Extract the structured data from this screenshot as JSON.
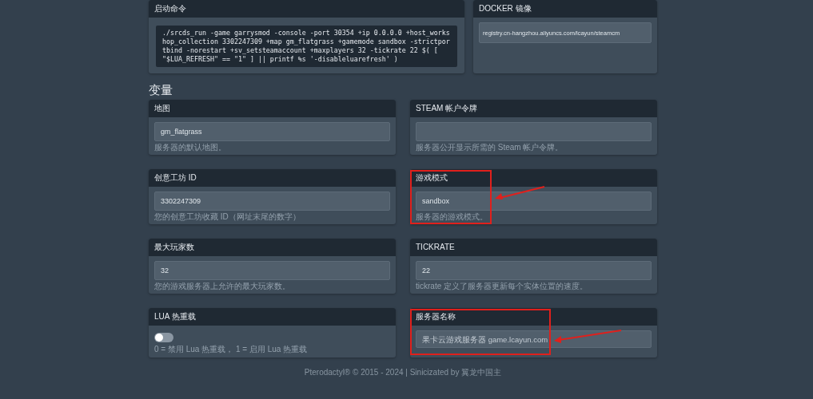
{
  "startup": {
    "title": "启动命令",
    "command": "./srcds_run -game garrysmod -console -port 30354 +ip 0.0.0.0 +host_workshop_collection 3302247309 +map gm_flatgrass +gamemode sandbox -strictportbind -norestart +sv_setsteamaccount +maxplayers 32 -tickrate 22 $( [ \"$LUA_REFRESH\" == \"1\" ] || printf %s '-disableluarefresh' )"
  },
  "docker": {
    "title": "DOCKER 镜像",
    "value": "registry.cn-hangzhou.aliyuncs.com/lcayun/steamcm"
  },
  "variables_title": "变量",
  "variables": [
    {
      "kind": "text",
      "label": "地图",
      "value": "gm_flatgrass",
      "description": "服务器的默认地图。",
      "annotated": false
    },
    {
      "kind": "text",
      "label": "STEAM 帐户令牌",
      "description": "服务器公开显示所需的 Steam 帐户令牌。",
      "annotated": false
    },
    {
      "kind": "text",
      "label": "创意工坊 ID",
      "value": "3302247309",
      "description": "您的创意工坊收藏 ID（网址末尾的数字）",
      "annotated": false
    },
    {
      "kind": "text",
      "label": "游戏模式",
      "value": "sandbox",
      "description": "服务器的游戏模式。",
      "annotated": true
    },
    {
      "kind": "text",
      "label": "最大玩家数",
      "value": "32",
      "description": "您的游戏服务器上允许的最大玩家数。",
      "annotated": false
    },
    {
      "kind": "text",
      "label": "TICKRATE",
      "value": "22",
      "description": "tickrate 定义了服务器更新每个实体位置的速度。",
      "annotated": false
    },
    {
      "kind": "toggle",
      "label": "LUA 热重载",
      "on": false,
      "description": "0 = 禁用 Lua 热重载， 1 = 启用 Lua 热重载",
      "annotated": false
    },
    {
      "kind": "text",
      "label": "服务器名称",
      "placeholder": "果卡云游戏服务器 game.lcayun.com",
      "annotated": true
    }
  ],
  "footer": "Pterodactyl® © 2015 - 2024 | Sinicizated by 翼龙中国主"
}
